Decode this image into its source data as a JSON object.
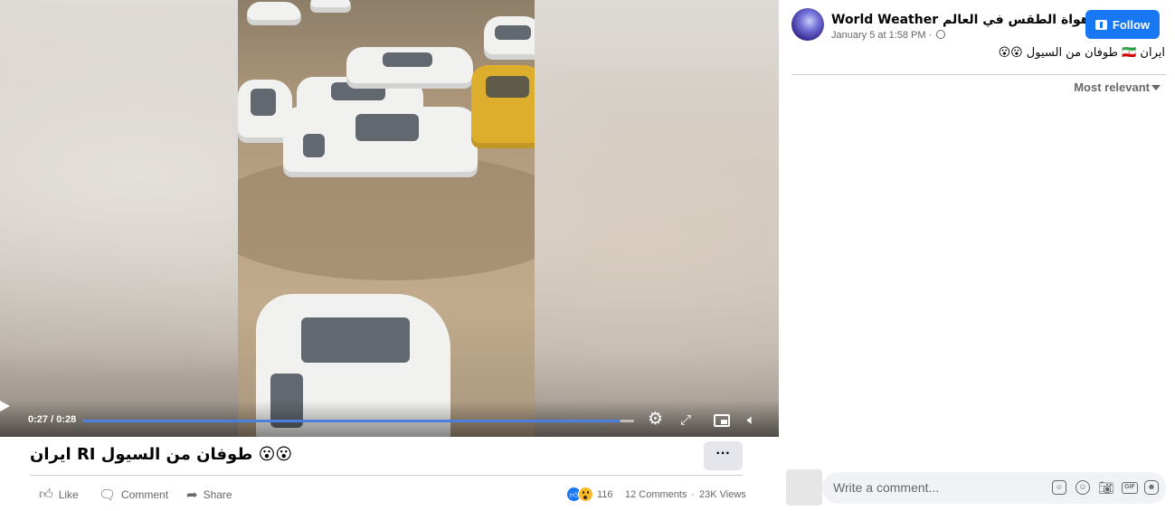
{
  "video": {
    "current_time": "0:27",
    "separator": " / ",
    "duration": "0:28",
    "progress": 0.975
  },
  "post": {
    "title": "ايران RI طوفان من السيول 😮😮",
    "more_label": "···"
  },
  "actions": {
    "like_label": "Like",
    "comment_label": "Comment",
    "share_label": "Share"
  },
  "stats": {
    "reaction_count": "116",
    "comments": "12 Comments",
    "views": "23K Views",
    "separator": "·"
  },
  "page": {
    "name": "World Weather هواة الطقس في العالم",
    "date": "January 5 at 1:58 PM",
    "meta_separator": " · ",
    "follow_label": "Follow",
    "caption": "ايران 🇮🇷 طوفان من السيول 😮😮"
  },
  "comments_sort": {
    "selected": "Most relevant"
  },
  "comment_composer": {
    "placeholder": "Write a comment..."
  },
  "colors": {
    "accent": "#1877f2",
    "progress": "#4a7fe0",
    "secondary_text": "#65676b"
  },
  "icons": [
    "play-icon",
    "gear-icon",
    "fullscreen-icon",
    "pip-icon",
    "mute-icon",
    "thumbs-up-icon",
    "comment-icon",
    "share-icon",
    "globe-icon",
    "caret-down-icon",
    "sticker-icon",
    "emoji-icon",
    "camera-icon",
    "gif-icon"
  ]
}
